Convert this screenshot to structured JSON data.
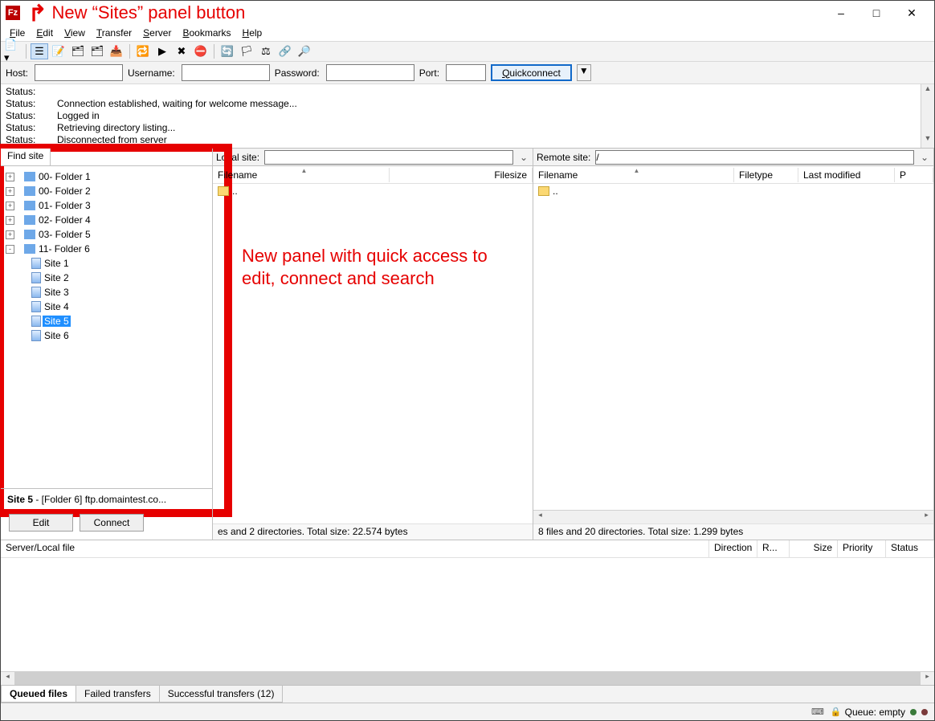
{
  "annot": {
    "title": "New “Sites” panel button",
    "main": "New panel with quick access to edit, connect and search"
  },
  "menu": {
    "file": "File",
    "edit": "Edit",
    "view": "View",
    "transfer": "Transfer",
    "server": "Server",
    "bookmarks": "Bookmarks",
    "help": "Help"
  },
  "qc": {
    "host_lbl": "Host:",
    "user_lbl": "Username:",
    "pass_lbl": "Password:",
    "port_lbl": "Port:",
    "button": "Quickconnect",
    "host": "",
    "user": "",
    "pass": "",
    "port": ""
  },
  "log": [
    {
      "k": "Status:",
      "v": ""
    },
    {
      "k": "Status:",
      "v": "Connection established, waiting for welcome message..."
    },
    {
      "k": "Status:",
      "v": "Logged in"
    },
    {
      "k": "Status:",
      "v": "Retrieving directory listing..."
    },
    {
      "k": "Status:",
      "v": "Disconnected from server"
    }
  ],
  "sites": {
    "find_tab": "Find site",
    "folders": [
      {
        "exp": "+",
        "label": "00- Folder 1"
      },
      {
        "exp": "+",
        "label": "00- Folder 2"
      },
      {
        "exp": "+",
        "label": "01- Folder 3"
      },
      {
        "exp": "+",
        "label": "02- Folder 4"
      },
      {
        "exp": "+",
        "label": "03- Folder 5"
      },
      {
        "exp": "-",
        "label": "11- Folder 6"
      }
    ],
    "children": [
      {
        "label": "Site 1",
        "sel": false
      },
      {
        "label": "Site 2",
        "sel": false
      },
      {
        "label": "Site 3",
        "sel": false
      },
      {
        "label": "Site 4",
        "sel": false
      },
      {
        "label": "Site 5",
        "sel": true
      },
      {
        "label": "Site 6",
        "sel": false
      }
    ],
    "info_bold": "Site 5",
    "info_rest": " - [Folder 6] ftp.domaintest.co...",
    "edit_btn": "Edit",
    "connect_btn": "Connect"
  },
  "local": {
    "label": "Local site:",
    "path": "",
    "cols": {
      "name": "Filename",
      "size": "Filesize"
    },
    "rows": [
      ".."
    ],
    "status_suffix": "es and 2 directories. Total size: 22.574 bytes"
  },
  "remote": {
    "label": "Remote site:",
    "path": "/",
    "cols": {
      "name": "Filename",
      "type": "Filetype",
      "mod": "Last modified",
      "perm": "P"
    },
    "rows": [
      ".."
    ],
    "status": "8 files and 20 directories. Total size: 1.299 bytes"
  },
  "queue": {
    "cols": {
      "file": "Server/Local file",
      "dir": "Direction",
      "remote": "R...",
      "size": "Size",
      "prio": "Priority",
      "status": "Status"
    }
  },
  "btabs": {
    "queued": "Queued files",
    "failed": "Failed transfers",
    "success": "Successful transfers (12)"
  },
  "footer": {
    "queue": "Queue: empty"
  }
}
